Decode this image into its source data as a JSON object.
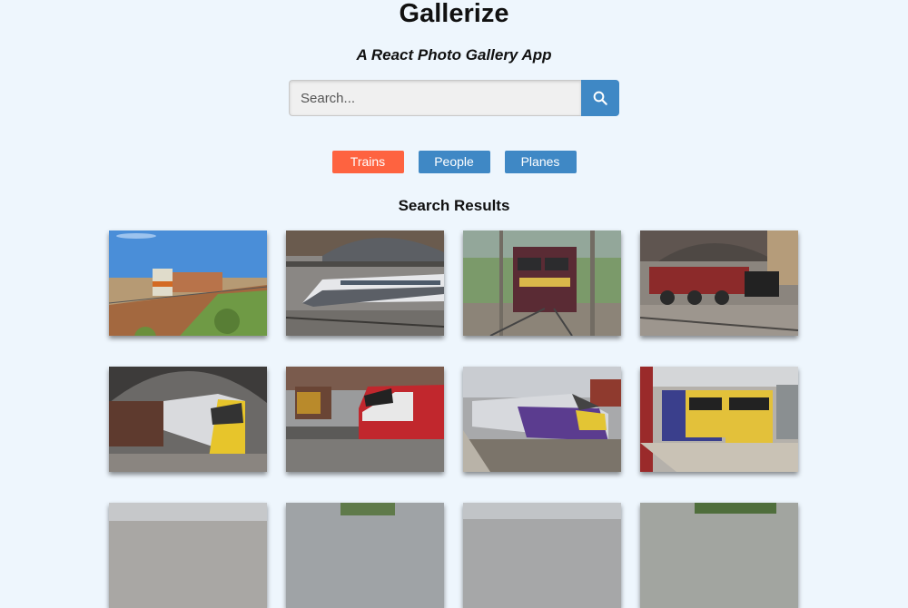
{
  "header": {
    "title": "Gallerize",
    "subtitle": "A React Photo Gallery App"
  },
  "search": {
    "placeholder": "Search...",
    "button_icon": "search-icon"
  },
  "nav": {
    "items": [
      {
        "label": "Trains",
        "active": true
      },
      {
        "label": "People",
        "active": false
      },
      {
        "label": "Planes",
        "active": false
      }
    ]
  },
  "results": {
    "title": "Search Results",
    "photos": [
      {
        "subject": "train"
      },
      {
        "subject": "train"
      },
      {
        "subject": "train"
      },
      {
        "subject": "train"
      },
      {
        "subject": "train"
      },
      {
        "subject": "train"
      },
      {
        "subject": "train"
      },
      {
        "subject": "train"
      },
      {
        "subject": "train"
      },
      {
        "subject": "train"
      },
      {
        "subject": "train"
      },
      {
        "subject": "train"
      }
    ]
  },
  "colors": {
    "background": "#eef6fd",
    "accent": "#3f88c5",
    "active": "#fe6340"
  }
}
